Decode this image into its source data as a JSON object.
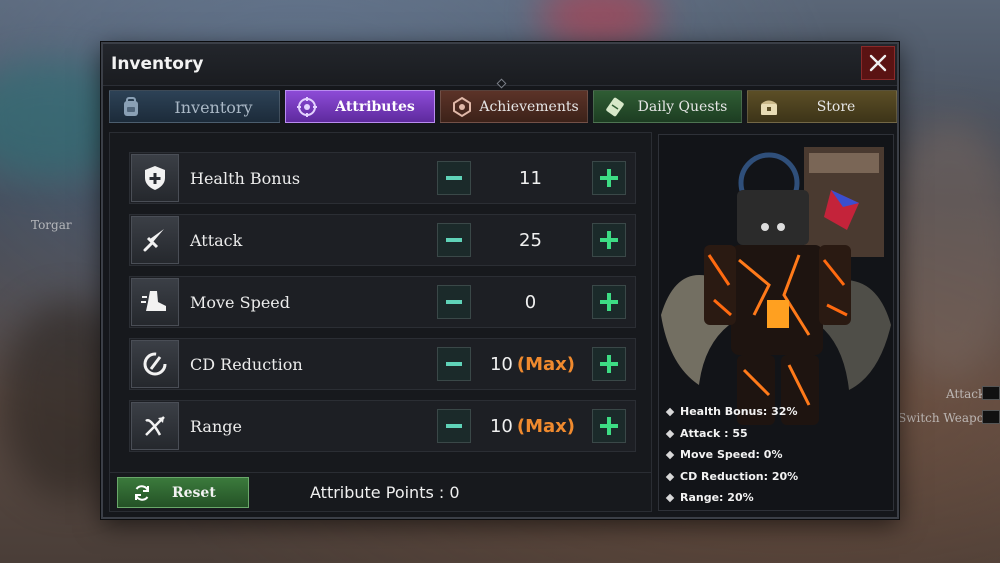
{
  "panel": {
    "title": "Inventory"
  },
  "tabs": [
    {
      "label": "Inventory"
    },
    {
      "label": "Attributes"
    },
    {
      "label": "Achievements"
    },
    {
      "label": "Daily Quests"
    },
    {
      "label": "Store"
    }
  ],
  "attributes": [
    {
      "name": "Health Bonus",
      "value": "11",
      "max_label": ""
    },
    {
      "name": "Attack",
      "value": "25",
      "max_label": ""
    },
    {
      "name": "Move Speed",
      "value": "0",
      "max_label": ""
    },
    {
      "name": "CD Reduction",
      "value": "10",
      "max_label": "(Max)"
    },
    {
      "name": "Range",
      "value": "10",
      "max_label": "(Max)"
    }
  ],
  "footer": {
    "reset_label": "Reset",
    "points_label": "Attribute Points : 0"
  },
  "stats": [
    "Health Bonus: 32%",
    "Attack : 55",
    "Move Speed: 0%",
    "CD Reduction: 20%",
    "Range: 20%"
  ],
  "background": {
    "npc_name": "Torgar",
    "hint_attack": "Attack",
    "hint_switch": "Switch Weapon"
  },
  "colors": {
    "accent_purple": "#8d4bd7",
    "max_orange": "#f08a2e",
    "plus_green": "#3ddc84",
    "minus_teal": "#5fd3b8",
    "close_red": "#5a1313"
  }
}
